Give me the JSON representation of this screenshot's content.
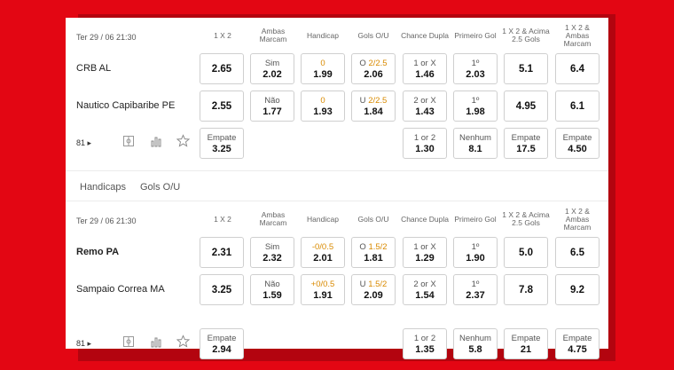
{
  "headers": [
    "1 X 2",
    "Ambas Marcam",
    "Handicap",
    "Gols O/U",
    "Chance Dupla",
    "Primeiro Gol",
    "1 X 2 & Acima 2.5 Gols",
    "1 X 2 & Ambas Marcam"
  ],
  "tabs": [
    "Handicaps",
    "Gols O/U"
  ],
  "matches": [
    {
      "date": "Ter 29 / 06 21:30",
      "home": "CRB AL",
      "away": "Nautico Capibaribe PE",
      "more": "81 ▸",
      "home_odds": {
        "x12": "2.65",
        "btts": {
          "label": "Sim",
          "odd": "2.02"
        },
        "handicap": {
          "line": "0",
          "odd": "1.99"
        },
        "ou": {
          "prefix": "O",
          "line": "2/2.5",
          "odd": "2.06"
        },
        "dc": {
          "label": "1 or X",
          "odd": "1.46"
        },
        "fg": {
          "label": "1º",
          "odd": "2.03"
        },
        "x12_over": "5.1",
        "x12_btts": "6.4"
      },
      "away_odds": {
        "x12": "2.55",
        "btts": {
          "label": "Não",
          "odd": "1.77"
        },
        "handicap": {
          "line": "0",
          "odd": "1.93"
        },
        "ou": {
          "prefix": "U",
          "line": "2/2.5",
          "odd": "1.84"
        },
        "dc": {
          "label": "2 or X",
          "odd": "1.43"
        },
        "fg": {
          "label": "1º",
          "odd": "1.98"
        },
        "x12_over": "4.95",
        "x12_btts": "6.1"
      },
      "draw_odds": {
        "x12": {
          "label": "Empate",
          "odd": "3.25"
        },
        "dc": {
          "label": "1 or 2",
          "odd": "1.30"
        },
        "fg": {
          "label": "Nenhum",
          "odd": "8.1"
        },
        "x12_over": {
          "label": "Empate",
          "odd": "17.5"
        },
        "x12_btts": {
          "label": "Empate",
          "odd": "4.50"
        }
      }
    },
    {
      "date": "Ter 29 / 06 21:30",
      "home": "Remo PA",
      "away": "Sampaio Correa MA",
      "more": "81 ▸",
      "home_odds": {
        "x12": "2.31",
        "btts": {
          "label": "Sim",
          "odd": "2.32"
        },
        "handicap": {
          "line": "-0/0.5",
          "odd": "2.01"
        },
        "ou": {
          "prefix": "O",
          "line": "1.5/2",
          "odd": "1.81"
        },
        "dc": {
          "label": "1 or X",
          "odd": "1.29"
        },
        "fg": {
          "label": "1º",
          "odd": "1.90"
        },
        "x12_over": "5.0",
        "x12_btts": "6.5"
      },
      "away_odds": {
        "x12": "3.25",
        "btts": {
          "label": "Não",
          "odd": "1.59"
        },
        "handicap": {
          "line": "+0/0.5",
          "odd": "1.91"
        },
        "ou": {
          "prefix": "U",
          "line": "1.5/2",
          "odd": "2.09"
        },
        "dc": {
          "label": "2 or X",
          "odd": "1.54"
        },
        "fg": {
          "label": "1º",
          "odd": "2.37"
        },
        "x12_over": "7.8",
        "x12_btts": "9.2"
      },
      "draw_odds": {
        "x12": {
          "label": "Empate",
          "odd": "2.94"
        },
        "dc": {
          "label": "1 or 2",
          "odd": "1.35"
        },
        "fg": {
          "label": "Nenhum",
          "odd": "5.8"
        },
        "x12_over": {
          "label": "Empate",
          "odd": "21"
        },
        "x12_btts": {
          "label": "Empate",
          "odd": "4.75"
        }
      }
    }
  ],
  "icons": [
    "field-icon",
    "stats-icon",
    "star-icon"
  ],
  "colors": {
    "background": "#e30613",
    "highlight": "#d98a00"
  }
}
